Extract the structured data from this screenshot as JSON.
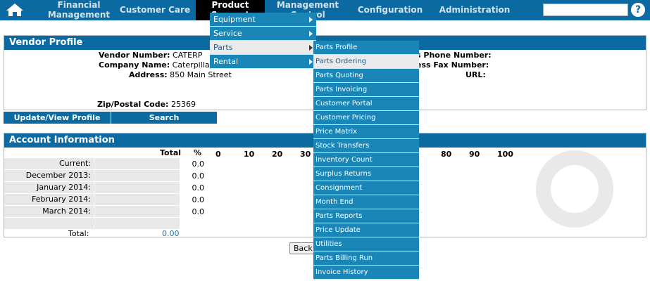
{
  "nav": {
    "home_icon": "home-icon",
    "items": [
      {
        "label1": "Financial",
        "label2": "Management"
      },
      {
        "label": "Customer Care"
      },
      {
        "label1": "Product",
        "label2": "Support"
      },
      {
        "label1": "Management",
        "label2": "Control"
      },
      {
        "label": "Configuration"
      },
      {
        "label": "Administration"
      }
    ],
    "search_value": "",
    "help_icon": "?"
  },
  "vendor": {
    "title": "Vendor Profile",
    "vendor_number_label": "Vendor Number:",
    "vendor_number": "CATERP",
    "company_label": "Company Name:",
    "company": "Caterpillar",
    "address_label": "Address:",
    "address": "850 Main Street",
    "zip_label": "Zip/Postal Code:",
    "zip": "25369",
    "phone_label": "s Phone Number:",
    "fax_label": "ess Fax Number:",
    "url_label": "URL:",
    "update_button": "Update/View Profile",
    "search_button": "Search"
  },
  "account": {
    "title": "Account Information",
    "total_header": "Total",
    "pct_header": "%",
    "ticks": [
      "0",
      "10",
      "20",
      "30",
      "80",
      "90",
      "100"
    ],
    "rows": [
      {
        "label": "Current:",
        "pct": "0.0"
      },
      {
        "label": "December 2013:",
        "pct": "0.0"
      },
      {
        "label": "January 2014:",
        "pct": "0.0"
      },
      {
        "label": "February 2014:",
        "pct": "0.0"
      },
      {
        "label": "March 2014:",
        "pct": "0.0"
      },
      {
        "label": "",
        "pct": ""
      }
    ],
    "total_label": "Total:",
    "total_value": "0.00"
  },
  "back_button": "Back",
  "menu1": [
    {
      "label": "Equipment"
    },
    {
      "label": "Service"
    },
    {
      "label": "Parts"
    },
    {
      "label": "Rental"
    }
  ],
  "menu2": [
    "Parts Profile",
    "Parts Ordering",
    "Parts Quoting",
    "Parts Invoicing",
    "Customer Portal",
    "Customer Pricing",
    "Price Matrix",
    "Stock Transfers",
    "Inventory Count",
    "Surplus Returns",
    "Consignment",
    "Month End",
    "Parts Reports",
    "Price Update",
    "Utilities",
    "Parts Billing Run",
    "Invoice History"
  ],
  "colors": {
    "nav_bg": "#0a6aa1",
    "menu_bg": "#1a86b8",
    "menu_hover": "#eaeaea"
  }
}
